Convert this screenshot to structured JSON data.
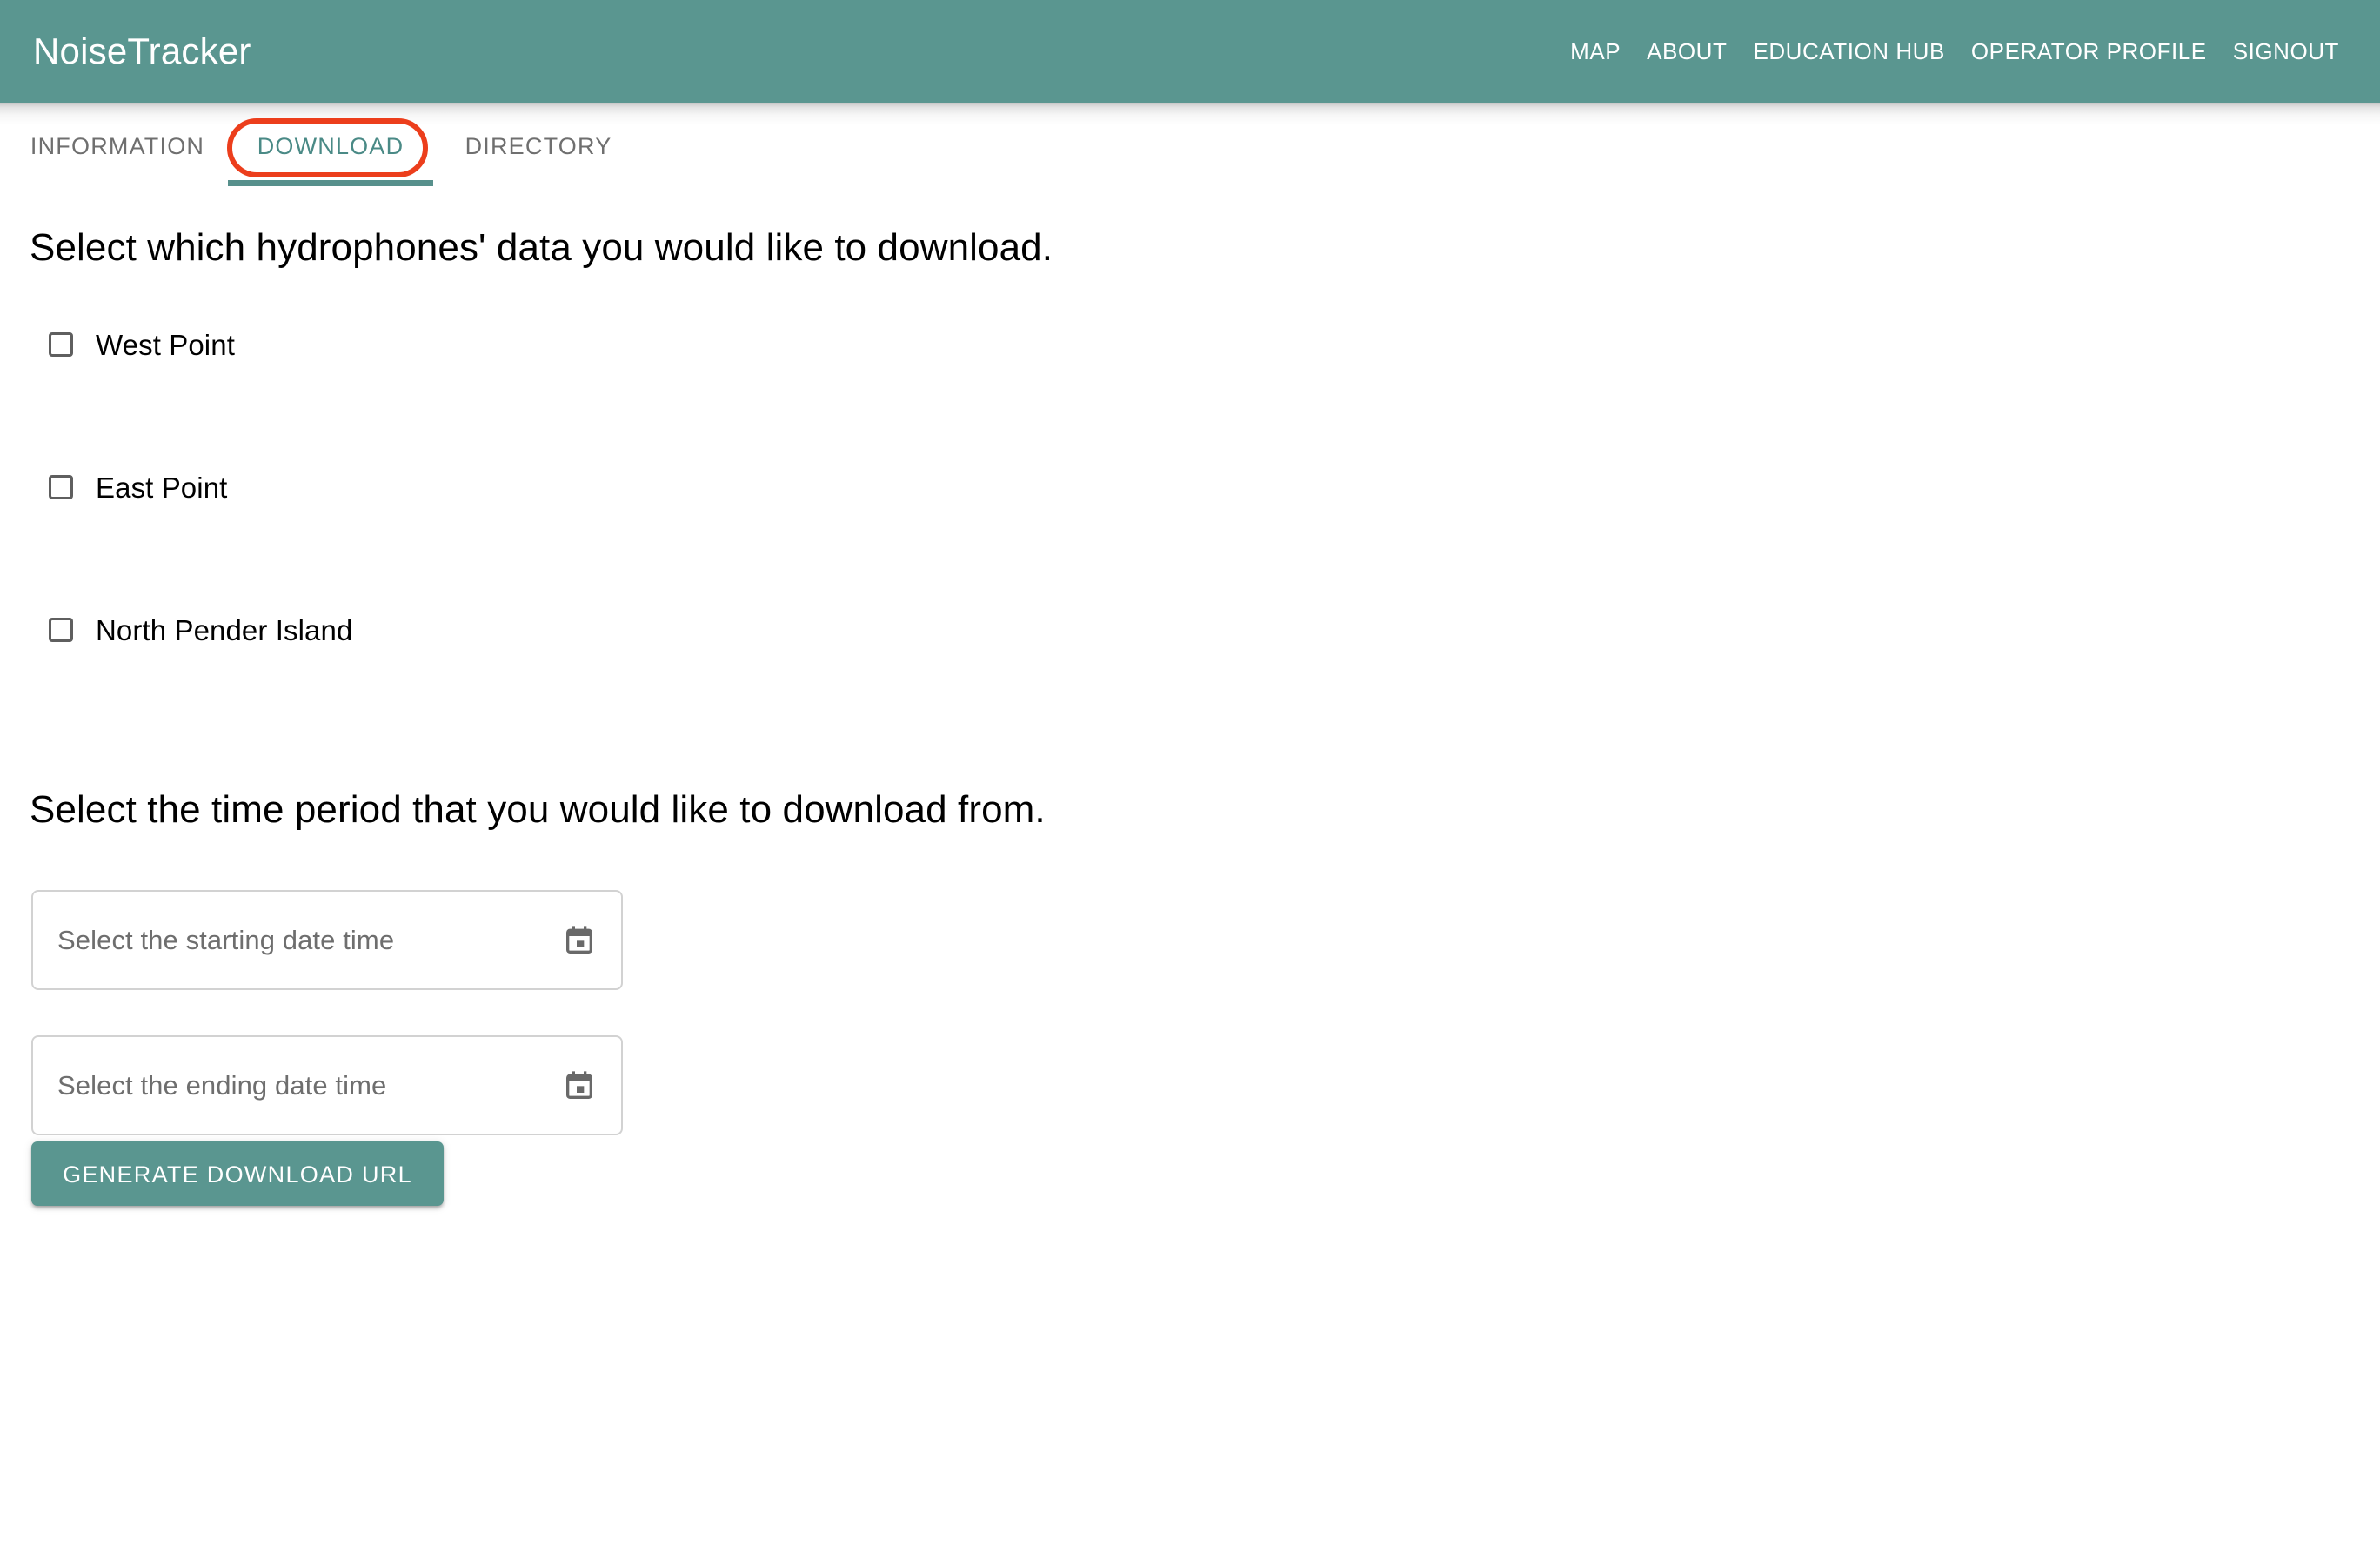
{
  "appbar": {
    "brand": "NoiseTracker",
    "nav": [
      {
        "label": "MAP"
      },
      {
        "label": "ABOUT"
      },
      {
        "label": "EDUCATION HUB"
      },
      {
        "label": "OPERATOR PROFILE"
      },
      {
        "label": "SIGNOUT"
      }
    ]
  },
  "tabs": [
    {
      "label": "INFORMATION",
      "active": false
    },
    {
      "label": "DOWNLOAD",
      "active": true
    },
    {
      "label": "DIRECTORY",
      "active": false
    }
  ],
  "main": {
    "hydrophone_heading": "Select which hydrophones' data you would like to download.",
    "hydrophones": [
      {
        "label": "West Point",
        "checked": false
      },
      {
        "label": "East Point",
        "checked": false
      },
      {
        "label": "North Pender Island",
        "checked": false
      }
    ],
    "time_heading": "Select the time period that you would like to download from.",
    "date_fields": [
      {
        "placeholder": "Select the starting date time",
        "value": "",
        "icon": "calendar-icon"
      },
      {
        "placeholder": "Select the ending date time",
        "value": "",
        "icon": "calendar-icon"
      }
    ],
    "generate_button": "GENERATE DOWNLOAD URL"
  },
  "colors": {
    "brand_teal": "#5a9690",
    "tab_active": "#4a8a86",
    "tab_inactive": "#6f6f6f",
    "tab_underline": "#57908c",
    "annotation_red": "#ec3e1c",
    "field_border": "#d2d2d2",
    "placeholder_text": "#6e6e6e",
    "checkbox_border": "#5f5f5f"
  }
}
